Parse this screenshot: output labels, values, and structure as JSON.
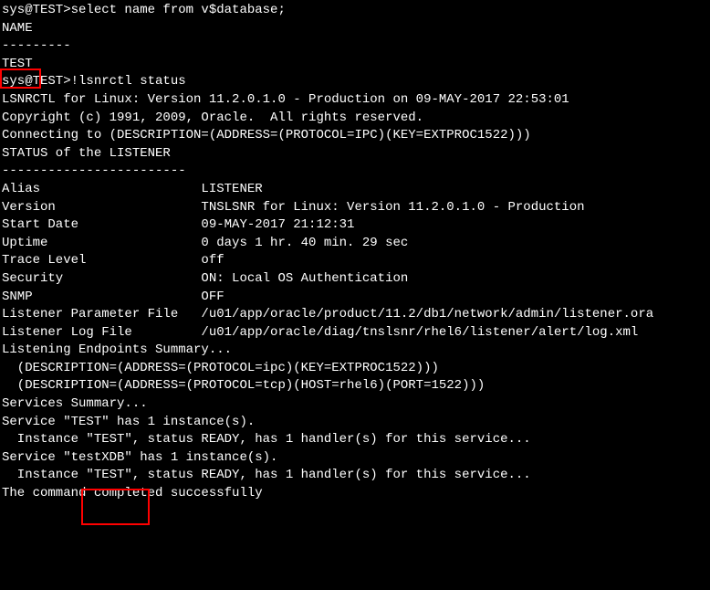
{
  "terminal": {
    "lines": [
      "sys@TEST>select name from v$database;",
      "",
      "NAME",
      "---------",
      "TEST",
      "",
      "sys@TEST>!lsnrctl status",
      "",
      "LSNRCTL for Linux: Version 11.2.0.1.0 - Production on 09-MAY-2017 22:53:01",
      "",
      "Copyright (c) 1991, 2009, Oracle.  All rights reserved.",
      "",
      "Connecting to (DESCRIPTION=(ADDRESS=(PROTOCOL=IPC)(KEY=EXTPROC1522)))",
      "STATUS of the LISTENER",
      "------------------------",
      "Alias                     LISTENER",
      "Version                   TNSLSNR for Linux: Version 11.2.0.1.0 - Production",
      "Start Date                09-MAY-2017 21:12:31",
      "Uptime                    0 days 1 hr. 40 min. 29 sec",
      "Trace Level               off",
      "Security                  ON: Local OS Authentication",
      "SNMP                      OFF",
      "Listener Parameter File   /u01/app/oracle/product/11.2/db1/network/admin/listener.ora",
      "Listener Log File         /u01/app/oracle/diag/tnslsnr/rhel6/listener/alert/log.xml",
      "Listening Endpoints Summary...",
      "  (DESCRIPTION=(ADDRESS=(PROTOCOL=ipc)(KEY=EXTPROC1522)))",
      "  (DESCRIPTION=(ADDRESS=(PROTOCOL=tcp)(HOST=rhel6)(PORT=1522)))",
      "Services Summary...",
      "Service \"TEST\" has 1 instance(s).",
      "  Instance \"TEST\", status READY, has 1 handler(s) for this service...",
      "Service \"testXDB\" has 1 instance(s).",
      "  Instance \"TEST\", status READY, has 1 handler(s) for this service...",
      "The command completed successfully"
    ]
  }
}
